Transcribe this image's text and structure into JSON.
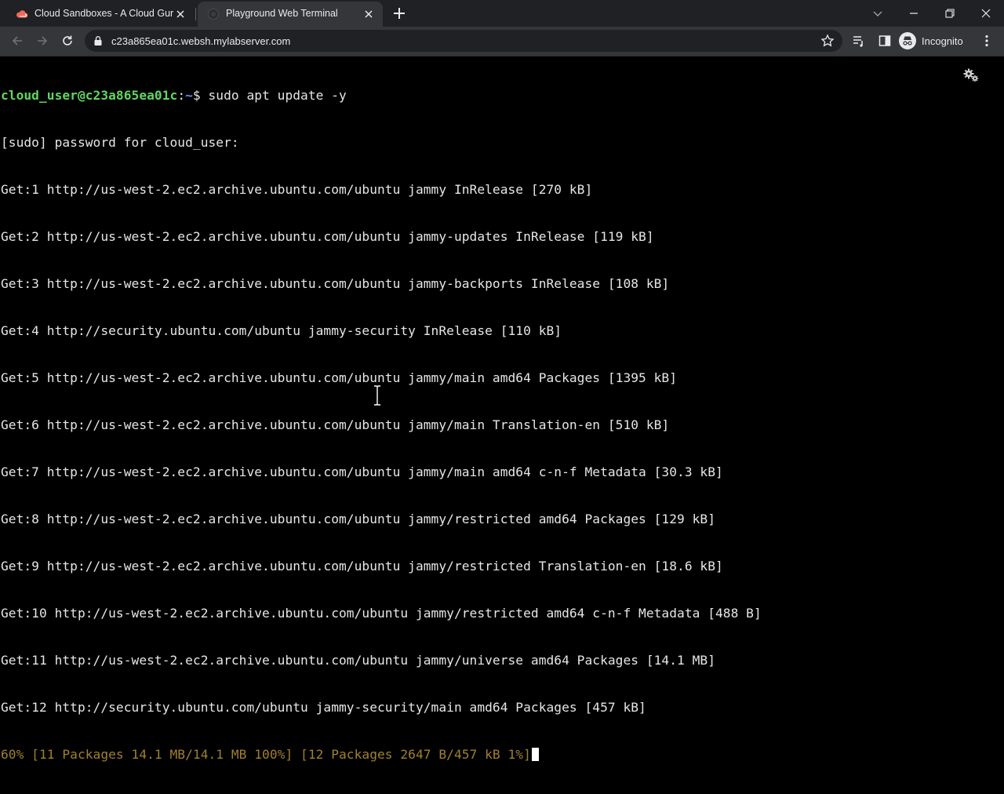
{
  "browser": {
    "tabs": [
      {
        "title": "Cloud Sandboxes - A Cloud Guru",
        "active": false
      },
      {
        "title": "Playground Web Terminal",
        "active": true
      }
    ],
    "url": "c23a865ea01c.websh.mylabserver.com",
    "profile_label": "Incognito"
  },
  "terminal": {
    "prompt_user": "cloud_user@c23a865ea01c",
    "prompt_sep": ":",
    "prompt_path": "~",
    "prompt_symbol": "$ ",
    "command": "sudo apt update -y",
    "output_lines": [
      "[sudo] password for cloud_user:",
      "Get:1 http://us-west-2.ec2.archive.ubuntu.com/ubuntu jammy InRelease [270 kB]",
      "Get:2 http://us-west-2.ec2.archive.ubuntu.com/ubuntu jammy-updates InRelease [119 kB]",
      "Get:3 http://us-west-2.ec2.archive.ubuntu.com/ubuntu jammy-backports InRelease [108 kB]",
      "Get:4 http://security.ubuntu.com/ubuntu jammy-security InRelease [110 kB]",
      "Get:5 http://us-west-2.ec2.archive.ubuntu.com/ubuntu jammy/main amd64 Packages [1395 kB]",
      "Get:6 http://us-west-2.ec2.archive.ubuntu.com/ubuntu jammy/main Translation-en [510 kB]",
      "Get:7 http://us-west-2.ec2.archive.ubuntu.com/ubuntu jammy/main amd64 c-n-f Metadata [30.3 kB]",
      "Get:8 http://us-west-2.ec2.archive.ubuntu.com/ubuntu jammy/restricted amd64 Packages [129 kB]",
      "Get:9 http://us-west-2.ec2.archive.ubuntu.com/ubuntu jammy/restricted Translation-en [18.6 kB]",
      "Get:10 http://us-west-2.ec2.archive.ubuntu.com/ubuntu jammy/restricted amd64 c-n-f Metadata [488 B]",
      "Get:11 http://us-west-2.ec2.archive.ubuntu.com/ubuntu jammy/universe amd64 Packages [14.1 MB]",
      "Get:12 http://security.ubuntu.com/ubuntu jammy-security/main amd64 Packages [457 kB]"
    ],
    "progress_line": "60% [11 Packages 14.1 MB/14.1 MB 100%] [12 Packages 2647 B/457 kB 1%]"
  },
  "colors": {
    "tabstrip_bg": "#202124",
    "toolbar_bg": "#35363a",
    "terminal_bg": "#000000",
    "prompt_user": "#5fd75f",
    "prompt_path": "#5c8cff",
    "progress_text": "#a08030"
  },
  "icons": {
    "favicon_tab1": "cloud-icon",
    "favicon_tab2": "terminal-icon",
    "settings": "gear-icon",
    "pointer": "i-beam-cursor-icon"
  }
}
